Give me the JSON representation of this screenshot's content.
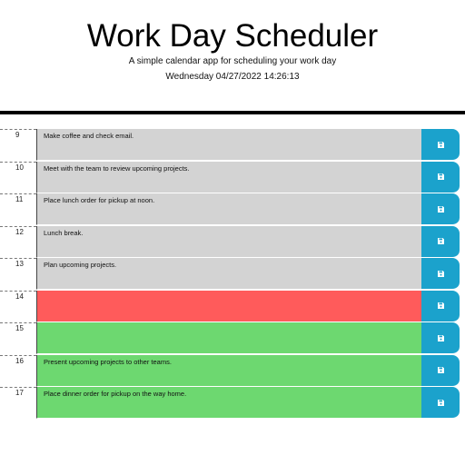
{
  "header": {
    "title": "Work Day Scheduler",
    "subtitle": "A simple calendar app for scheduling your work day",
    "datetime": "Wednesday 04/27/2022 14:26:13"
  },
  "schedule": [
    {
      "hour": "9",
      "text": "Make coffee and check email.",
      "state": "past"
    },
    {
      "hour": "10",
      "text": "Meet with the team to review upcoming projects.",
      "state": "past"
    },
    {
      "hour": "11",
      "text": "Place lunch order for pickup at noon.",
      "state": "past"
    },
    {
      "hour": "12",
      "text": "Lunch break.",
      "state": "past"
    },
    {
      "hour": "13",
      "text": "Plan upcoming projects.",
      "state": "past"
    },
    {
      "hour": "14",
      "text": "",
      "state": "present"
    },
    {
      "hour": "15",
      "text": "",
      "state": "future"
    },
    {
      "hour": "16",
      "text": "Present upcoming projects to other teams.",
      "state": "future"
    },
    {
      "hour": "17",
      "text": "Place dinner order for pickup on the way home.",
      "state": "future"
    }
  ],
  "save_icon": "save-icon",
  "colors": {
    "past": "#d3d3d3",
    "present": "#ff5b5b",
    "future": "#6dd870",
    "save_button": "#1ba2cc"
  }
}
